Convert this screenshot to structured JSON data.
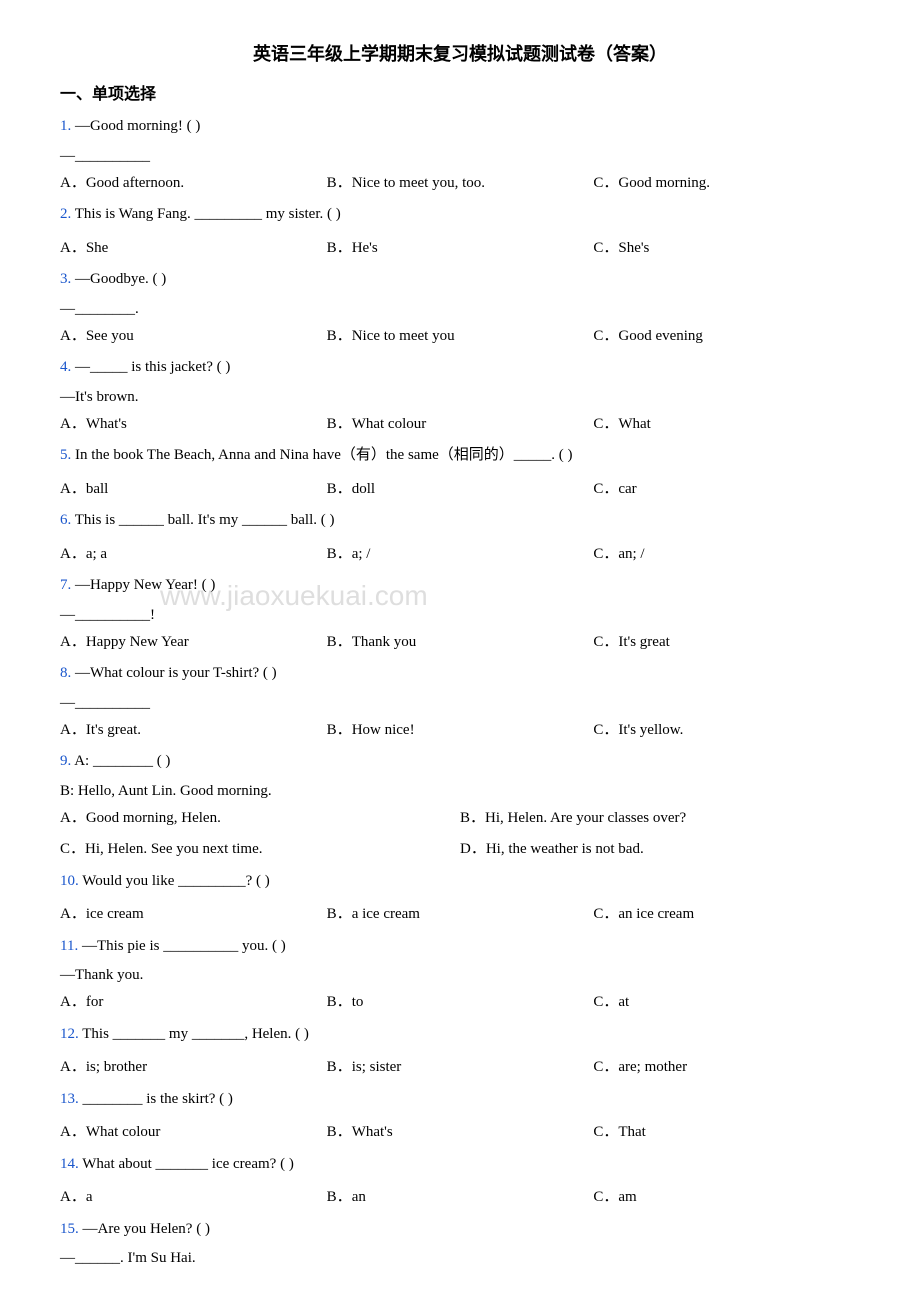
{
  "title": "英语三年级上学期期末复习模拟试题测试卷（答案）",
  "section1": "一、单项选择",
  "watermark": "www.jiaoxuekuai.com",
  "questions": [
    {
      "num": "1.",
      "text": "—Good morning! ( )",
      "answer_line": "—__________",
      "options": [
        {
          "label": "A．",
          "text": "Good afternoon."
        },
        {
          "label": "B．",
          "text": "Nice to meet you, too."
        },
        {
          "label": "C．",
          "text": "Good morning."
        }
      ]
    },
    {
      "num": "2.",
      "text": "This is Wang Fang. _________ my sister. ( )",
      "options": [
        {
          "label": "A．",
          "text": "She"
        },
        {
          "label": "B．",
          "text": "He's"
        },
        {
          "label": "C．",
          "text": "She's"
        }
      ]
    },
    {
      "num": "3.",
      "text": "—Goodbye. ( )",
      "answer_line": "—________.",
      "options": [
        {
          "label": "A．",
          "text": "See you"
        },
        {
          "label": "B．",
          "text": "Nice to meet you"
        },
        {
          "label": "C．",
          "text": "Good evening"
        }
      ]
    },
    {
      "num": "4.",
      "text": "—_____ is this jacket? ( )",
      "sub_answer": "—It's brown.",
      "options": [
        {
          "label": "A．",
          "text": "What's"
        },
        {
          "label": "B．",
          "text": "What colour"
        },
        {
          "label": "C．",
          "text": "What"
        }
      ]
    },
    {
      "num": "5.",
      "text": "In the book The Beach, Anna and Nina have（有）the same（相同的）_____. ( )",
      "options": [
        {
          "label": "A．",
          "text": "ball"
        },
        {
          "label": "B．",
          "text": "doll"
        },
        {
          "label": "C．",
          "text": "car"
        }
      ]
    },
    {
      "num": "6.",
      "text": "This is ______ ball. It's my ______ ball. ( )",
      "options": [
        {
          "label": "A．",
          "text": "a; a"
        },
        {
          "label": "B．",
          "text": "a; /"
        },
        {
          "label": "C．",
          "text": "an; /"
        }
      ]
    },
    {
      "num": "7.",
      "text": "—Happy New Year! ( )",
      "answer_line": "—__________!",
      "options": [
        {
          "label": "A．",
          "text": "Happy New Year"
        },
        {
          "label": "B．",
          "text": "Thank you"
        },
        {
          "label": "C．",
          "text": "It's great"
        }
      ]
    },
    {
      "num": "8.",
      "text": "—What colour is your T-shirt? ( )",
      "answer_line": "—__________",
      "options": [
        {
          "label": "A．",
          "text": "It's great."
        },
        {
          "label": "B．",
          "text": "How nice!"
        },
        {
          "label": "C．",
          "text": "It's yellow."
        }
      ]
    },
    {
      "num": "9.",
      "text": "A: ________ ( )",
      "sub_answer": "B: Hello, Aunt Lin. Good morning.",
      "options_two_col": [
        {
          "label": "A．",
          "text": "Good morning, Helen."
        },
        {
          "label": "B．",
          "text": "Hi, Helen. Are your classes over?"
        },
        {
          "label": "C．",
          "text": "Hi, Helen. See you next time."
        },
        {
          "label": "D．",
          "text": "Hi, the weather is not bad."
        }
      ]
    },
    {
      "num": "10.",
      "text": "Would you like _________? ( )",
      "options": [
        {
          "label": "A．",
          "text": "ice cream"
        },
        {
          "label": "B．",
          "text": "a ice cream"
        },
        {
          "label": "C．",
          "text": "an ice cream"
        }
      ]
    },
    {
      "num": "11.",
      "text": "—This pie is __________ you. ( )",
      "sub_answer": "—Thank you.",
      "options": [
        {
          "label": "A．",
          "text": "for"
        },
        {
          "label": "B．",
          "text": "to"
        },
        {
          "label": "C．",
          "text": "at"
        }
      ]
    },
    {
      "num": "12.",
      "text": "This _______ my _______, Helen. ( )",
      "options": [
        {
          "label": "A．",
          "text": "is; brother"
        },
        {
          "label": "B．",
          "text": "is; sister"
        },
        {
          "label": "C．",
          "text": "are; mother"
        }
      ]
    },
    {
      "num": "13.",
      "text": "________ is the skirt? ( )",
      "options": [
        {
          "label": "A．",
          "text": "What colour"
        },
        {
          "label": "B．",
          "text": "What's"
        },
        {
          "label": "C．",
          "text": "That"
        }
      ]
    },
    {
      "num": "14.",
      "text": "What about _______ ice cream? ( )",
      "options": [
        {
          "label": "A．",
          "text": "a"
        },
        {
          "label": "B．",
          "text": "an"
        },
        {
          "label": "C．",
          "text": "am"
        }
      ]
    },
    {
      "num": "15.",
      "text": "—Are you Helen? ( )",
      "answer_line": "—______. I'm Su Hai."
    }
  ]
}
